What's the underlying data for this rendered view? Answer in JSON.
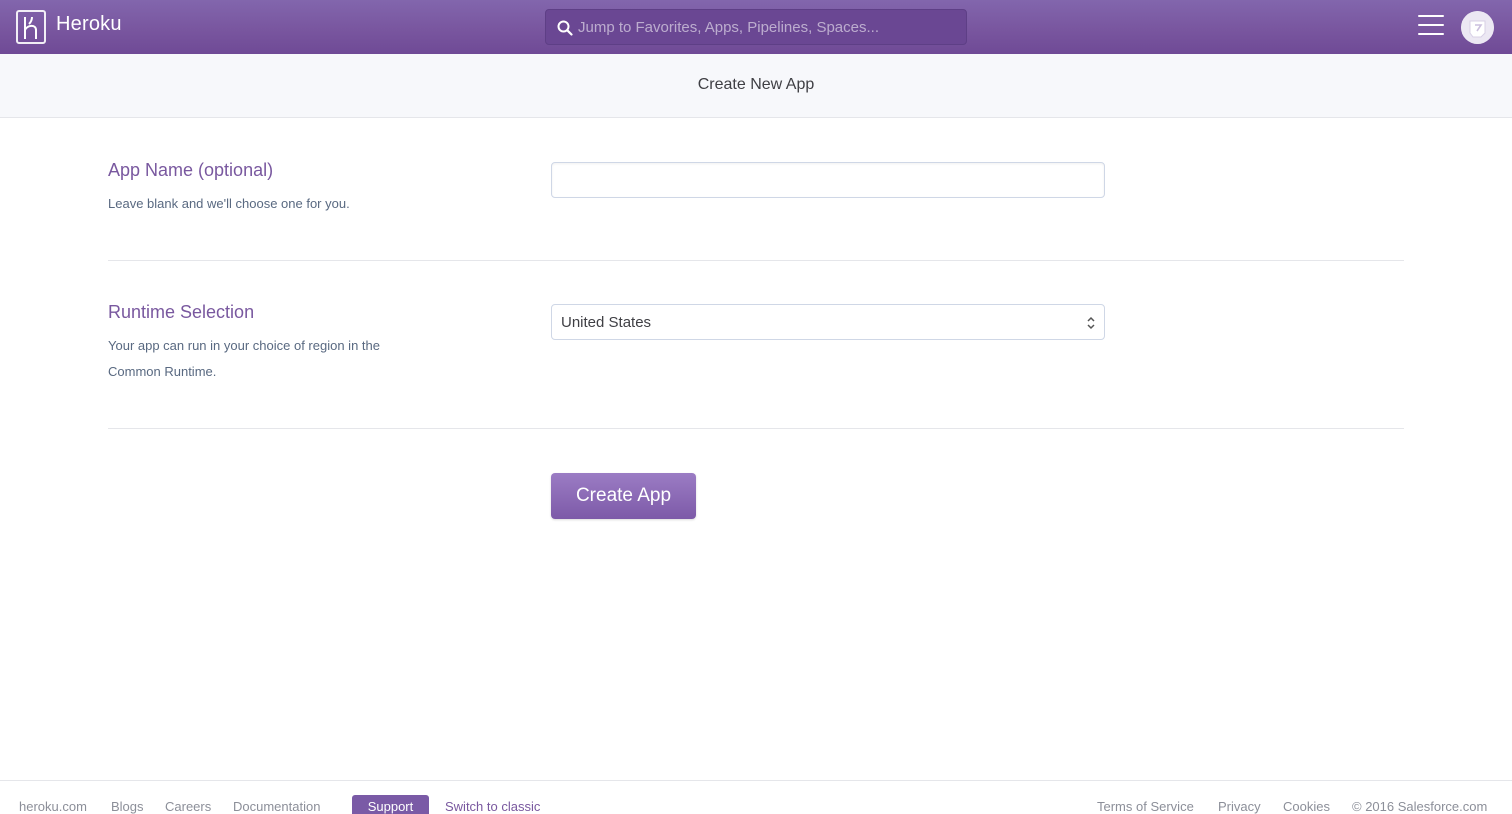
{
  "header": {
    "brand": "Heroku",
    "search_placeholder": "Jump to Favorites, Apps, Pipelines, Spaces...",
    "icons": [
      "heroku-logo-icon",
      "search-icon",
      "menu-icon",
      "avatar"
    ]
  },
  "page": {
    "title": "Create New App"
  },
  "app_name": {
    "label": "App Name (optional)",
    "description": "Leave blank and we'll choose one for you.",
    "value": ""
  },
  "runtime": {
    "label": "Runtime Selection",
    "description": "Your app can run in your choice of region in the Common Runtime.",
    "selected": "United States"
  },
  "actions": {
    "create_label": "Create App"
  },
  "footer": {
    "links_left": [
      "heroku.com",
      "Blogs",
      "Careers",
      "Documentation"
    ],
    "support": "Support",
    "switch": "Switch to classic",
    "links_right": [
      "Terms of Service",
      "Privacy",
      "Cookies",
      "© 2016 Salesforce.com"
    ]
  },
  "colors": {
    "brand_purple": "#79589f",
    "header_gradient": "#8266ad"
  }
}
